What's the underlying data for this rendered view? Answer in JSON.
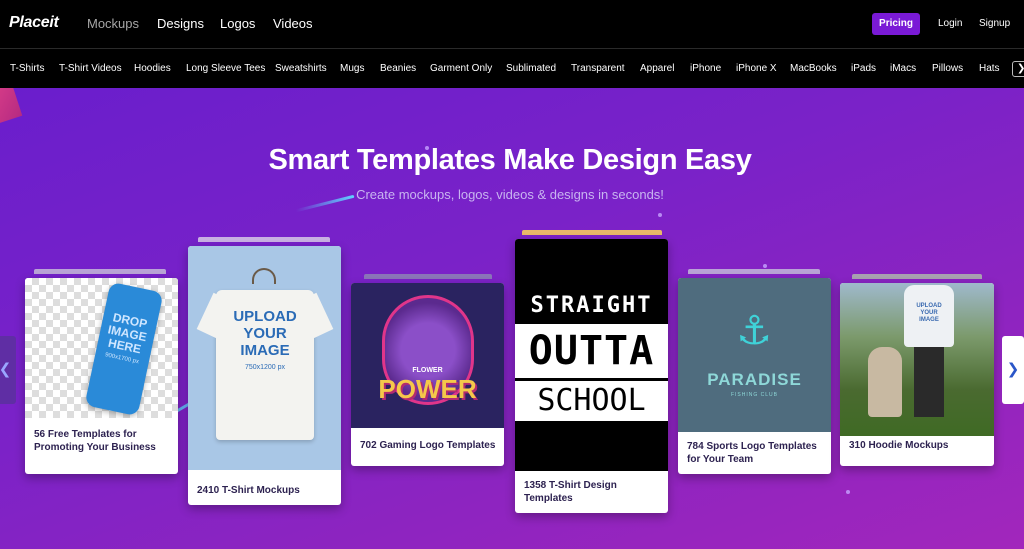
{
  "brand": {
    "logo": "Placeit"
  },
  "main_nav": [
    "Mockups",
    "Designs",
    "Logos",
    "Videos"
  ],
  "header_actions": {
    "pricing": "Pricing",
    "login": "Login",
    "signup": "Signup"
  },
  "categories": [
    "T-Shirts",
    "T-Shirt Videos",
    "Hoodies",
    "Long Sleeve Tees",
    "Sweatshirts",
    "Mugs",
    "Beanies",
    "Garment Only",
    "Sublimated",
    "Transparent",
    "Apparel",
    "iPhone",
    "iPhone X",
    "MacBooks",
    "iPads",
    "iMacs",
    "Pillows",
    "Hats"
  ],
  "hero": {
    "title": "Smart Templates Make Design Easy",
    "subtitle": "Create mockups, logos, videos & designs in seconds!"
  },
  "cards": [
    {
      "caption_1": "56 Free Templates for",
      "caption_2": "Promoting Your Business",
      "thumb_text": [
        "DROP",
        "IMAGE",
        "HERE",
        "900x1700 px"
      ]
    },
    {
      "caption_1": "2410 T-Shirt Mockups",
      "thumb_text": [
        "UPLOAD",
        "YOUR",
        "IMAGE",
        "750x1200 px"
      ]
    },
    {
      "caption_1": "702 Gaming Logo Templates",
      "thumb_text": [
        "FLOWER",
        "POWER"
      ]
    },
    {
      "caption_1": "1358 T-Shirt Design",
      "caption_2": "Templates",
      "thumb_text": [
        "STRAIGHT",
        "OUTTA",
        "SCHOOL"
      ]
    },
    {
      "caption_1": "784 Sports Logo Templates",
      "caption_2": "for Your Team",
      "thumb_text": [
        "PARADISE",
        "FISHING CLUB"
      ]
    },
    {
      "caption_1": "310 Hoodie Mockups",
      "thumb_text": [
        "UPLOAD",
        "YOUR",
        "IMAGE"
      ]
    }
  ],
  "colors": {
    "accent": "#7a1ad6",
    "hero_start": "#6a1ecc",
    "hero_end": "#a226bc",
    "caption": "#2d2250"
  },
  "icons": {
    "next": "chevron-right-icon",
    "prev": "chevron-left-icon"
  }
}
